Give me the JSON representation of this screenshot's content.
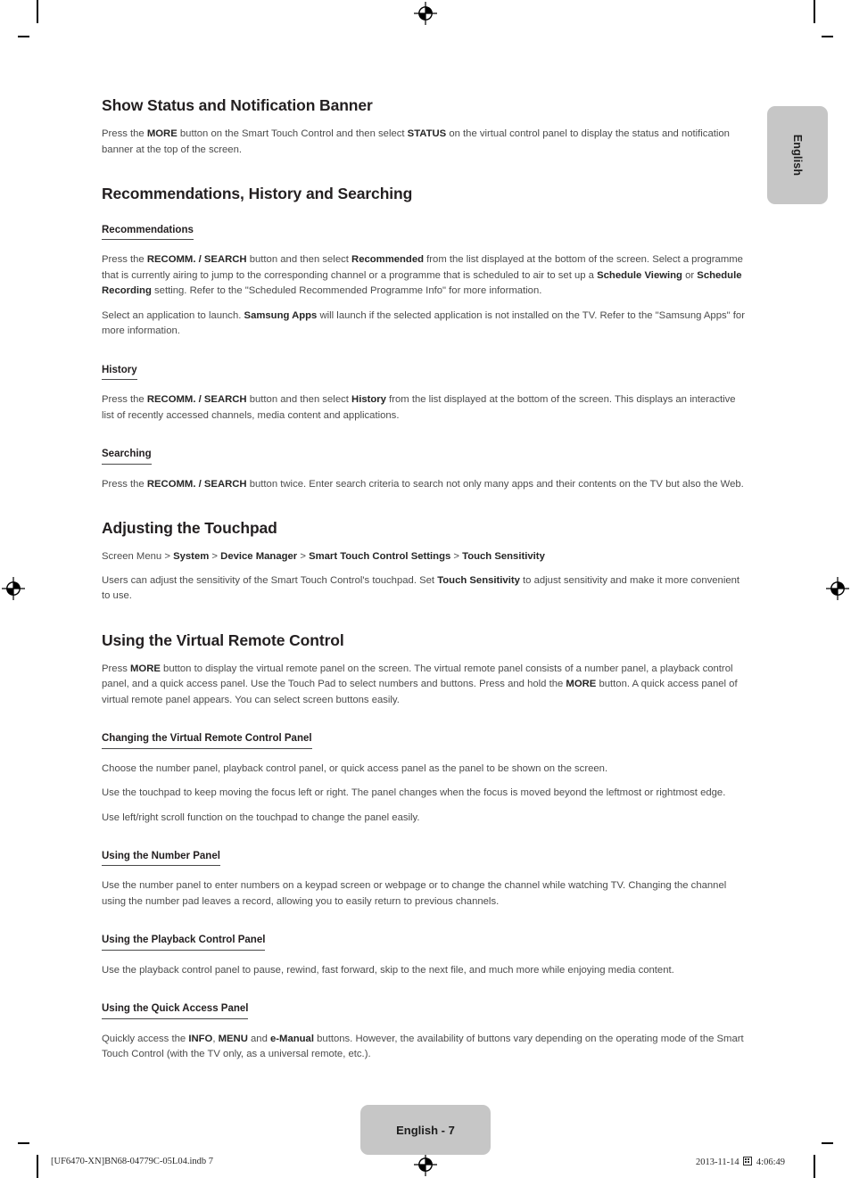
{
  "page": {
    "language_tab": "English",
    "page_badge": "English - 7",
    "footer_file": "[UF6470-XN]BN68-04779C-05L04.indb   7",
    "footer_date": "2013-11-14",
    "footer_time": "4:06:49"
  },
  "sections": [
    {
      "id": "show-status",
      "title": "Show Status and Notification Banner",
      "paragraphs": [
        {
          "runs": [
            {
              "t": "Press the "
            },
            {
              "t": "MORE",
              "b": true
            },
            {
              "t": " button on the Smart Touch Control and then select "
            },
            {
              "t": "STATUS",
              "b": true
            },
            {
              "t": " on the virtual control panel to display the status and notification banner at the top of the screen."
            }
          ]
        }
      ]
    },
    {
      "id": "recommendations-history-searching",
      "title": "Recommendations, History and Searching",
      "subsections": [
        {
          "id": "recommendations",
          "heading": "Recommendations",
          "paragraphs": [
            {
              "runs": [
                {
                  "t": "Press the "
                },
                {
                  "t": "RECOMM. / SEARCH",
                  "b": true
                },
                {
                  "t": " button and then select "
                },
                {
                  "t": "Recommended",
                  "b": true
                },
                {
                  "t": " from the list displayed at the bottom of the screen. Select a programme that is currently airing to jump to the corresponding channel or a programme that is scheduled to air to set up a "
                },
                {
                  "t": "Schedule Viewing",
                  "b": true
                },
                {
                  "t": " or "
                },
                {
                  "t": "Schedule Recording",
                  "b": true
                },
                {
                  "t": " setting. Refer to the \"Scheduled Recommended Programme Info\" for more information."
                }
              ]
            },
            {
              "runs": [
                {
                  "t": "Select an application to launch. "
                },
                {
                  "t": "Samsung Apps",
                  "b": true
                },
                {
                  "t": " will launch if the selected application is not installed on the TV. Refer to the \"Samsung Apps\" for more information."
                }
              ]
            }
          ]
        },
        {
          "id": "history",
          "heading": "History",
          "paragraphs": [
            {
              "runs": [
                {
                  "t": "Press the "
                },
                {
                  "t": "RECOMM. / SEARCH",
                  "b": true
                },
                {
                  "t": " button and then select "
                },
                {
                  "t": "History",
                  "b": true
                },
                {
                  "t": " from the list displayed at the bottom of the screen. This displays an interactive list of recently accessed channels, media content and applications."
                }
              ]
            }
          ]
        },
        {
          "id": "searching",
          "heading": "Searching",
          "paragraphs": [
            {
              "runs": [
                {
                  "t": "Press the "
                },
                {
                  "t": "RECOMM. / SEARCH",
                  "b": true
                },
                {
                  "t": " button twice. Enter search criteria to search not only many apps and their contents on the TV but also the Web."
                }
              ]
            }
          ]
        }
      ]
    },
    {
      "id": "adjusting-the-touchpad",
      "title": "Adjusting the Touchpad",
      "menu_path": {
        "runs": [
          {
            "t": "Screen Menu"
          },
          {
            "t": " > "
          },
          {
            "t": "System",
            "b": true
          },
          {
            "t": " > "
          },
          {
            "t": "Device Manager",
            "b": true
          },
          {
            "t": " > "
          },
          {
            "t": "Smart Touch Control Settings",
            "b": true
          },
          {
            "t": " > "
          },
          {
            "t": "Touch Sensitivity",
            "b": true
          }
        ]
      },
      "paragraphs": [
        {
          "runs": [
            {
              "t": "Users can adjust the sensitivity of the Smart Touch Control's touchpad. Set "
            },
            {
              "t": "Touch Sensitivity",
              "b": true
            },
            {
              "t": " to adjust sensitivity and make it more convenient to use."
            }
          ]
        }
      ]
    },
    {
      "id": "using-virtual-remote-control",
      "title": "Using the Virtual Remote Control",
      "paragraphs": [
        {
          "runs": [
            {
              "t": "Press "
            },
            {
              "t": "MORE",
              "b": true
            },
            {
              "t": " button to display the virtual remote panel on the screen. The virtual remote panel consists of a number panel, a playback control panel, and a quick access panel. Use the Touch Pad to select numbers and buttons. Press and hold the "
            },
            {
              "t": "MORE",
              "b": true
            },
            {
              "t": " button. A quick access panel of virtual remote panel appears. You can select screen buttons easily."
            }
          ]
        }
      ],
      "subsections": [
        {
          "id": "changing-panel",
          "heading": "Changing the Virtual Remote Control Panel",
          "paragraphs": [
            {
              "runs": [
                {
                  "t": "Choose the number panel, playback control panel, or quick access panel as the panel to be shown on the screen."
                }
              ]
            },
            {
              "runs": [
                {
                  "t": "Use the touchpad to keep moving the focus left or right. The panel changes when the focus is moved beyond the leftmost or rightmost edge."
                }
              ]
            },
            {
              "runs": [
                {
                  "t": "Use left/right scroll function on the touchpad to change the panel easily."
                }
              ]
            }
          ]
        },
        {
          "id": "number-panel",
          "heading": "Using the Number Panel",
          "paragraphs": [
            {
              "runs": [
                {
                  "t": "Use the number panel to enter numbers on a keypad screen or webpage or to change the channel while watching TV. Changing the channel using the number pad leaves a record, allowing you to easily return to previous channels."
                }
              ]
            }
          ]
        },
        {
          "id": "playback-panel",
          "heading": "Using the Playback Control Panel",
          "paragraphs": [
            {
              "runs": [
                {
                  "t": "Use the playback control panel to pause, rewind, fast forward, skip to the next file, and much more while enjoying media content."
                }
              ]
            }
          ]
        },
        {
          "id": "quick-access-panel",
          "heading": "Using the Quick Access Panel",
          "paragraphs": [
            {
              "runs": [
                {
                  "t": "Quickly access the "
                },
                {
                  "t": "INFO",
                  "b": true
                },
                {
                  "t": ", "
                },
                {
                  "t": "MENU",
                  "b": true
                },
                {
                  "t": " and "
                },
                {
                  "t": "e-Manual",
                  "b": true
                },
                {
                  "t": " buttons. However, the availability of buttons vary depending on the operating mode of the Smart Touch Control (with the TV only, as a universal remote, etc.)."
                }
              ]
            }
          ]
        }
      ]
    }
  ]
}
